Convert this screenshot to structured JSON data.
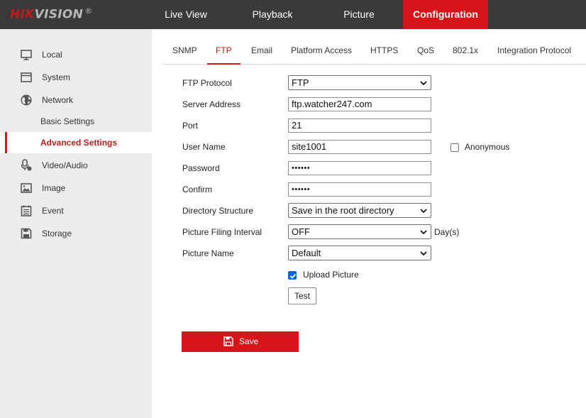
{
  "brand": {
    "name_red": "HIK",
    "name_gray": "VISION",
    "mark": "®"
  },
  "nav": {
    "items": [
      {
        "label": "Live View"
      },
      {
        "label": "Playback"
      },
      {
        "label": "Picture"
      },
      {
        "label": "Configuration",
        "active": true
      }
    ]
  },
  "sidebar": {
    "items": [
      {
        "label": "Local",
        "icon": "monitor-icon"
      },
      {
        "label": "System",
        "icon": "window-icon"
      },
      {
        "label": "Network",
        "icon": "globe-icon"
      },
      {
        "label": "Basic Settings",
        "sub": true
      },
      {
        "label": "Advanced Settings",
        "sub": true,
        "active": true
      },
      {
        "label": "Video/Audio",
        "icon": "microphone-camera-icon"
      },
      {
        "label": "Image",
        "icon": "image-icon"
      },
      {
        "label": "Event",
        "icon": "calendar-list-icon"
      },
      {
        "label": "Storage",
        "icon": "floppy-disk-icon"
      }
    ]
  },
  "tabs": [
    {
      "label": "SNMP"
    },
    {
      "label": "FTP",
      "active": true
    },
    {
      "label": "Email"
    },
    {
      "label": "Platform Access"
    },
    {
      "label": "HTTPS"
    },
    {
      "label": "QoS"
    },
    {
      "label": "802.1x"
    },
    {
      "label": "Integration Protocol"
    }
  ],
  "form": {
    "ftp_protocol": {
      "label": "FTP Protocol",
      "value": "FTP"
    },
    "server_address": {
      "label": "Server Address",
      "value": "ftp.watcher247.com"
    },
    "port": {
      "label": "Port",
      "value": "21"
    },
    "user_name": {
      "label": "User Name",
      "value": "site1001"
    },
    "anonymous": {
      "label": "Anonymous",
      "checked": false
    },
    "password": {
      "label": "Password",
      "value": "••••••"
    },
    "confirm": {
      "label": "Confirm",
      "value": "••••••"
    },
    "directory_structure": {
      "label": "Directory Structure",
      "value": "Save in the root directory"
    },
    "picture_filing_interval": {
      "label": "Picture Filing Interval",
      "value": "OFF",
      "unit": "Day(s)"
    },
    "picture_name": {
      "label": "Picture Name",
      "value": "Default"
    },
    "upload_picture": {
      "label": "Upload Picture",
      "checked": true
    },
    "test_label": "Test"
  },
  "save_label": "Save",
  "colors": {
    "accent": "#d7141a",
    "topbar": "#3a3a3a",
    "sidebar": "#ececec",
    "checkbox": "#0a66d6"
  }
}
